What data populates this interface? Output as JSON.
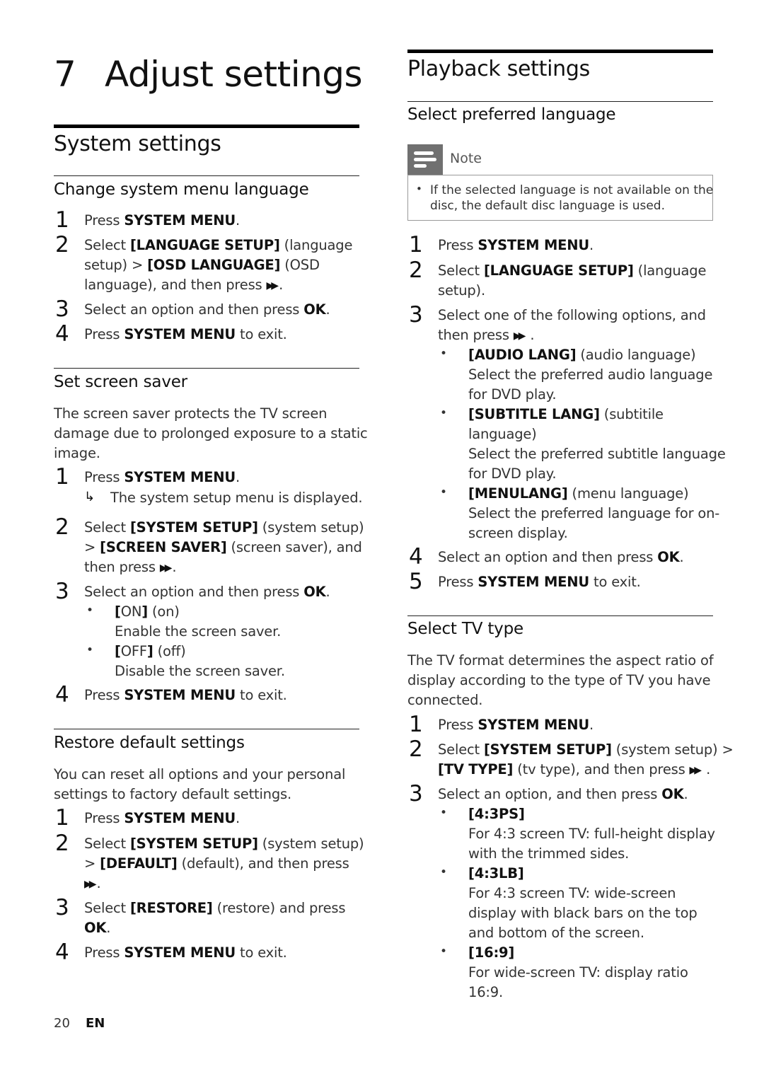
{
  "chapter": {
    "number": "7",
    "title": "Adjust settings"
  },
  "left": {
    "section_title": "System settings",
    "change_lang": {
      "title": "Change system menu language",
      "steps": [
        {
          "n": "1",
          "lines": [
            "Press <b>SYSTEM MENU</b>."
          ]
        },
        {
          "n": "2",
          "lines": [
            "Select <b>[LANGUAGE SETUP]</b> (language",
            "setup) &gt; <b>[OSD LANGUAGE]</b> (OSD",
            "language), and then press <ff>."
          ]
        },
        {
          "n": "3",
          "lines": [
            "Select an option and then press <b>OK</b>."
          ]
        },
        {
          "n": "4",
          "lines": [
            "Press <b>SYSTEM MENU</b> to exit."
          ]
        }
      ]
    },
    "screen_saver": {
      "title": "Set screen saver",
      "intro": [
        "The screen saver protects the TV screen",
        "damage due to prolonged exposure to a static",
        "image."
      ],
      "step1": "Press <b>SYSTEM MENU</b>.",
      "step1_result": "The system setup menu is displayed.",
      "step2": [
        "Select <b>[SYSTEM SETUP]</b> (system setup)",
        "&gt; <b>[SCREEN SAVER]</b> (screen saver), and",
        "then press <ff>."
      ],
      "step3": "Select an option and then press <b>OK</b>.",
      "options": [
        {
          "name": "<b>[</b>ON<b>]</b> (on)",
          "desc": "Enable the screen saver."
        },
        {
          "name": "<b>[</b>OFF<b>]</b> (off)",
          "desc": "Disable the screen saver."
        }
      ],
      "step4": "Press <b>SYSTEM MENU</b> to exit."
    },
    "restore": {
      "title": "Restore default settings",
      "intro": [
        "You can reset all options and your personal",
        "settings to factory default settings."
      ],
      "step1": "Press <b>SYSTEM MENU</b>.",
      "step2": [
        "Select <b>[SYSTEM SETUP]</b> (system setup)",
        "&gt; <b>[DEFAULT]</b> (default), and then press"
      ],
      "step3": [
        "Select <b>[RESTORE]</b> (restore) and press",
        "<b>OK</b>."
      ],
      "step4": "Press <b>SYSTEM MENU</b> to exit."
    }
  },
  "right": {
    "section_title": "Playback settings",
    "pref_lang": {
      "title": "Select preferred language",
      "note_label": "Note",
      "note_lines": [
        "If the selected language is not available on the",
        "disc, the default disc language is used."
      ],
      "step1": "Press <b>SYSTEM MENU</b>.",
      "step2": [
        "Select <b>[LANGUAGE SETUP]</b> (language",
        "setup)."
      ],
      "step3": [
        "Select one of the following options, and",
        "then press <ff> ."
      ],
      "options": [
        {
          "lines": [
            "<b>[AUDIO LANG]</b> (audio language)",
            "Select the preferred audio language",
            "for DVD play."
          ]
        },
        {
          "lines": [
            "<b>[SUBTITLE LANG]</b> (subtitile",
            "language)",
            "Select the preferred subtitle language",
            "for DVD play."
          ]
        },
        {
          "lines": [
            "<b>[MENULANG]</b> (menu language)",
            "Select the preferred language for on-",
            "screen display."
          ]
        }
      ],
      "step4": "Select an option and then press <b>OK</b>.",
      "step5": "Press <b>SYSTEM MENU</b> to exit."
    },
    "tv_type": {
      "title": "Select TV type",
      "intro": [
        "The TV format determines the aspect ratio of",
        "display according to the type of TV you have",
        "connected."
      ],
      "step1": "Press <b>SYSTEM MENU</b>.",
      "step2": [
        "Select <b>[SYSTEM SETUP]</b> (system setup) &gt;",
        "<b>[TV TYPE]</b> (tv type), and then press <ff> ."
      ],
      "step3": "Select an option, and then press <b>OK</b>.",
      "options": [
        {
          "lines": [
            "<b>[4:3PS]</b>",
            "For 4:3 screen TV: full-height display",
            "with the trimmed sides."
          ]
        },
        {
          "lines": [
            "<b>[4:3LB]</b>",
            "For 4:3 screen TV: wide-screen",
            "display with black bars on the top",
            "and bottom of the screen."
          ]
        },
        {
          "lines": [
            "<b>[16:9]</b>",
            "For wide-screen TV: display ratio",
            "16:9."
          ]
        }
      ]
    }
  },
  "footer": {
    "page": "20",
    "lang": "EN"
  }
}
